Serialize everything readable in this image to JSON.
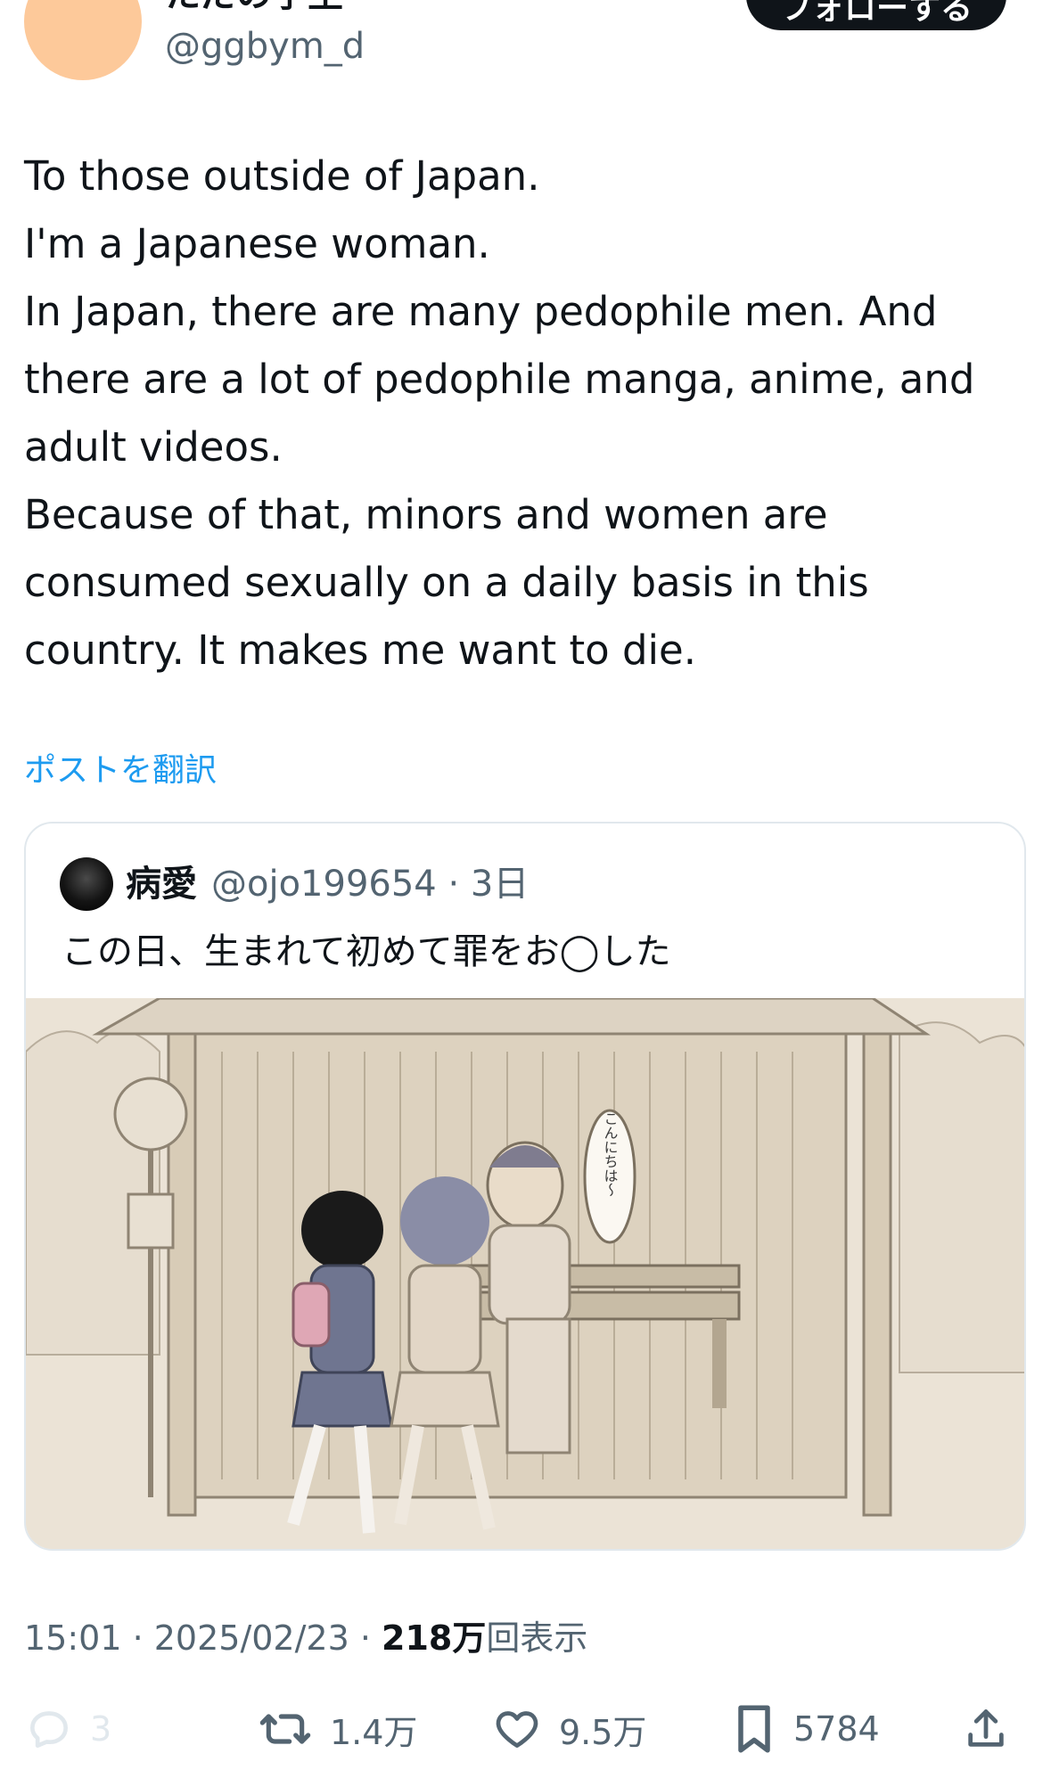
{
  "author": {
    "display_name": "ただの学生",
    "handle": "@ggbym_d",
    "follow_label": "フォローする",
    "avatar_color": "#fdc99a"
  },
  "tweet": {
    "lines": [
      "To those outside of Japan.",
      "I'm a Japanese woman.",
      "In Japan, there are many pedophile men. And",
      "there are a lot of pedophile manga, anime, and",
      "adult videos.",
      "Because of that, minors and women are",
      "consumed sexually on a daily basis in this",
      "country. It makes me want to die."
    ],
    "translate_label": "ポストを翻訳"
  },
  "quote": {
    "display_name": "病愛",
    "handle_time": "@ojo199654 · 3日",
    "text": "この日、生まれて初めて罪をお◯した",
    "image_speech": "こんにちは〜"
  },
  "meta": {
    "time_date": "15:01 · 2025/02/23 · ",
    "views_count": "218万",
    "views_label": "回表示"
  },
  "actions": {
    "reply_count": "3",
    "retweet_count": "1.4万",
    "like_count": "9.5万",
    "bookmark_count": "5784"
  },
  "colors": {
    "accent": "#1d9bf0",
    "muted": "#536471",
    "text": "#0f1419"
  }
}
